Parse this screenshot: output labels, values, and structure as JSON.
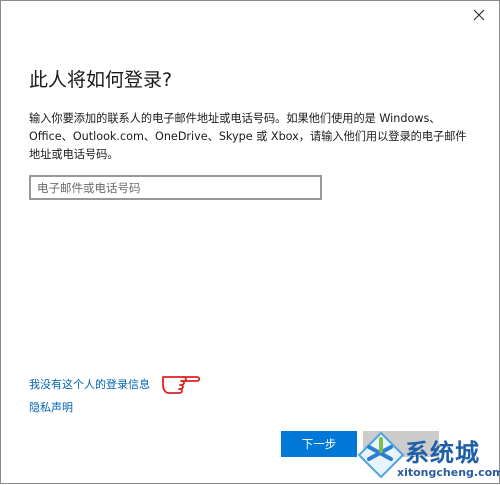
{
  "dialog": {
    "title": "此人将如何登录?",
    "description": "输入你要添加的联系人的电子邮件地址或电话号码。如果他们使用的是 Windows、Office、Outlook.com、OneDrive、Skype 或 Xbox，请输入他们用以登录的电子邮件地址或电话号码。",
    "email_input": {
      "value": "",
      "placeholder": "电子邮件或电话号码"
    },
    "link_no_signin": "我没有这个人的登录信息",
    "link_privacy": "隐私声明",
    "next_button": "下一步",
    "close_icon": "close-icon",
    "hand_icon": "pointing-hand-icon"
  },
  "watermark": {
    "name": "系统城",
    "url": "xitongcheng.com"
  },
  "colors": {
    "accent": "#0078d7",
    "link": "#0063b1",
    "hand": "#e02020"
  }
}
